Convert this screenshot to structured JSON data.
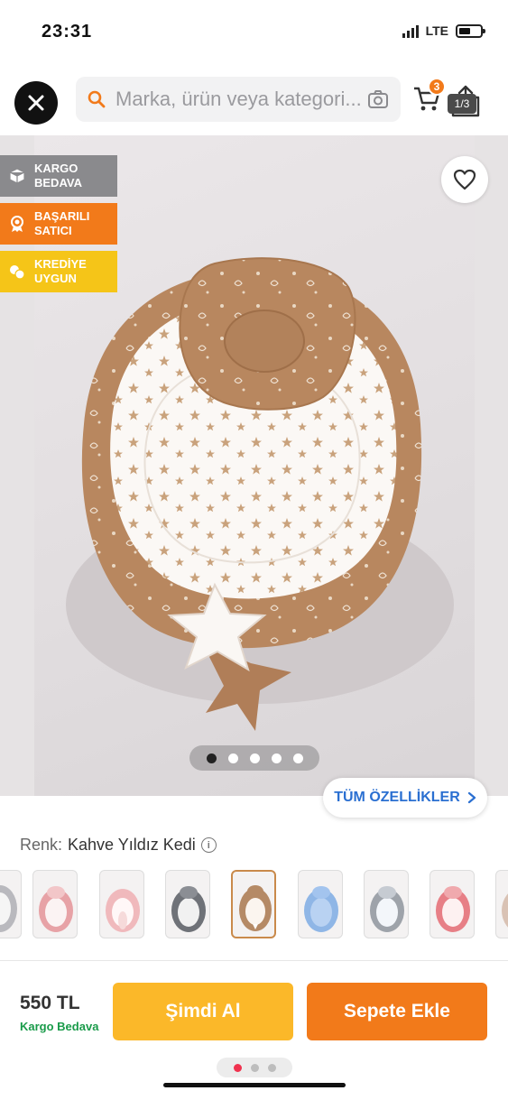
{
  "status_bar": {
    "time": "23:31",
    "network": "LTE"
  },
  "header": {
    "search_placeholder": "Marka, ürün veya kategori...",
    "cart_count": "3",
    "image_counter": "1/3"
  },
  "badges": [
    {
      "line1": "KARGO",
      "line2": "BEDAVA",
      "color": "#8a8a8d",
      "icon": "box-icon"
    },
    {
      "line1": "BAŞARILI",
      "line2": "SATICI",
      "color": "#f27a1a",
      "icon": "medal-icon"
    },
    {
      "line1": "KREDİYE",
      "line2": "UYGUN",
      "color": "#f5c518",
      "icon": "coins-icon"
    }
  ],
  "gallery": {
    "dot_count": 5,
    "active_dot": 1
  },
  "features_button": {
    "label": "TÜM ÖZELLİKLER"
  },
  "variant": {
    "label": "Renk:",
    "value": "Kahve Yıldız Kedi"
  },
  "thumbnails": [
    {
      "name": "grey",
      "accent": "#b9b9be"
    },
    {
      "name": "pink-floral",
      "accent": "#e7a2a6"
    },
    {
      "name": "pink-bunny",
      "accent": "#f0b9bc"
    },
    {
      "name": "grey-stars",
      "accent": "#6f7278"
    },
    {
      "name": "brown-star-cat",
      "accent": "#b58a66",
      "selected": true
    },
    {
      "name": "blue",
      "accent": "#8fb6e6"
    },
    {
      "name": "grey-blue",
      "accent": "#9ea3aa"
    },
    {
      "name": "pink-coral",
      "accent": "#e77f86"
    },
    {
      "name": "partial",
      "accent": "#d9c2b4"
    }
  ],
  "purchase": {
    "price": "550 TL",
    "shipping": "Kargo Bedava",
    "buy_now": "Şimdi Al",
    "add_to_cart": "Sepete Ekle"
  },
  "colors": {
    "accent_orange": "#f27a1a",
    "accent_yellow": "#fbb829",
    "link_blue": "#2a6fd1",
    "green": "#1a9b4a"
  }
}
